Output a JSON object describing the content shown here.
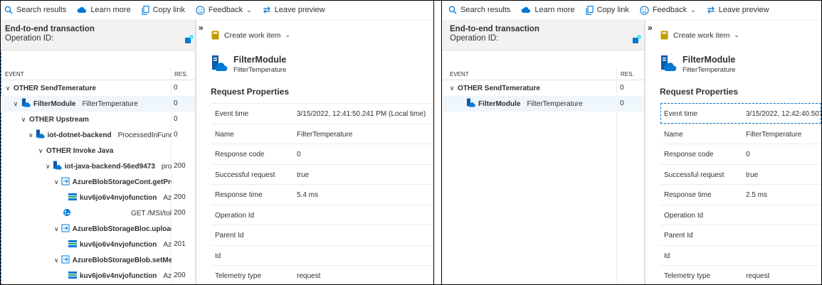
{
  "toolbar": {
    "search": "Search results",
    "learn": "Learn more",
    "copy": "Copy link",
    "feedback": "Feedback",
    "leave": "Leave preview"
  },
  "left_panel": {
    "title": "End-to-end transaction",
    "operation_label": "Operation ID:",
    "col_event": "EVENT",
    "col_res": "RES."
  },
  "detail": {
    "create_work_item": "Create work item",
    "module_title": "FilterModule",
    "module_sub": "FilterTemperature",
    "section": "Request Properties"
  },
  "screen1": {
    "rows": [
      {
        "name": "OTHER SendTemerature",
        "op": "",
        "res": "0"
      },
      {
        "name": "FilterModule",
        "op": "FilterTemperature",
        "res": "0"
      },
      {
        "name": "OTHER Upstream",
        "op": "",
        "res": "0"
      },
      {
        "name": "iot-dotnet-backend",
        "op": "ProcessedInFunct",
        "res": "0"
      },
      {
        "name": "OTHER Invoke Java",
        "op": "",
        "res": ""
      },
      {
        "name": "iot-java-backend-56ed9473",
        "op": "pro",
        "res": "200"
      },
      {
        "name": "AzureBlobStorageCont.getPro",
        "op": "",
        "res": ""
      },
      {
        "name": "kuv6jo6v4nvjofunction",
        "op": "Az",
        "res": "200"
      },
      {
        "name": "",
        "op": "GET /MSI/tol",
        "res": "200"
      },
      {
        "name": "AzureBlobStorageBloc.upload",
        "op": "",
        "res": ""
      },
      {
        "name": "kuv6jo6v4nvjofunction",
        "op": "Az",
        "res": "201"
      },
      {
        "name": "AzureBlobStorageBlob.setMet",
        "op": "",
        "res": ""
      },
      {
        "name": "kuv6jo6v4nvjofunction",
        "op": "Az",
        "res": "200"
      }
    ],
    "props": [
      {
        "k": "Event time",
        "v": "3/15/2022, 12:41:50.241 PM (Local time)"
      },
      {
        "k": "Name",
        "v": "FilterTemperature"
      },
      {
        "k": "Response code",
        "v": "0"
      },
      {
        "k": "Successful request",
        "v": "true"
      },
      {
        "k": "Response time",
        "v": "5.4 ms"
      },
      {
        "k": "Operation Id",
        "v": ""
      },
      {
        "k": "Parent Id",
        "v": ""
      },
      {
        "k": "Id",
        "v": ""
      },
      {
        "k": "Telemetry type",
        "v": "request"
      }
    ]
  },
  "screen2": {
    "rows": [
      {
        "name": "OTHER SendTemerature",
        "op": "",
        "res": "0"
      },
      {
        "name": "FilterModule",
        "op": "FilterTemperature",
        "res": "0"
      }
    ],
    "props": [
      {
        "k": "Event time",
        "v": "3/15/2022, 12:42:40.507 P"
      },
      {
        "k": "Name",
        "v": "FilterTemperature"
      },
      {
        "k": "Response code",
        "v": "0"
      },
      {
        "k": "Successful request",
        "v": "true"
      },
      {
        "k": "Response time",
        "v": "2.5 ms"
      },
      {
        "k": "Operation Id",
        "v": ""
      },
      {
        "k": "Parent Id",
        "v": ""
      },
      {
        "k": "Id",
        "v": ""
      },
      {
        "k": "Telemetry type",
        "v": "request"
      }
    ]
  },
  "colors": {
    "accent": "#0078d4",
    "selected_row": "#eff6fc",
    "header_bg": "#f3f2f1"
  }
}
